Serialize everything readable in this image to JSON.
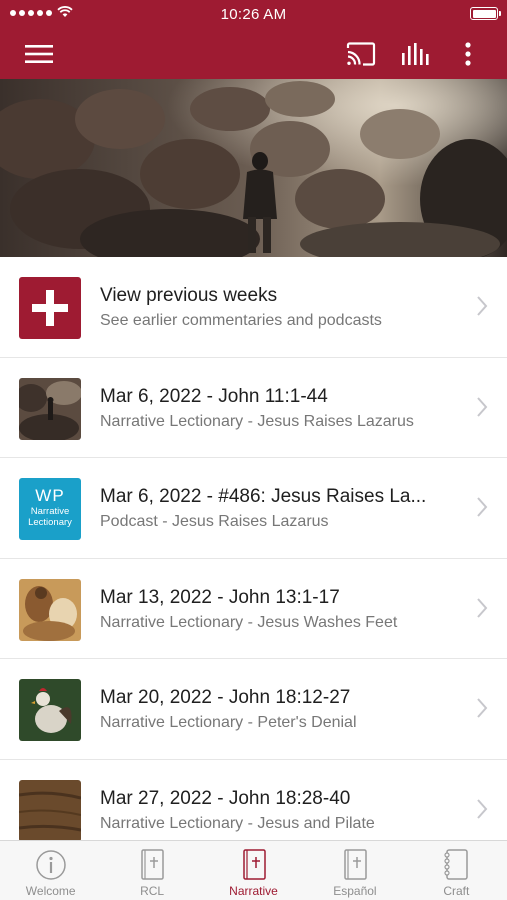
{
  "status_bar": {
    "time": "10:26 AM"
  },
  "app_bar": {
    "menu_icon": "hamburger-menu-icon",
    "cast_icon": "cast-icon",
    "audio_icon": "equalizer-icon",
    "more_icon": "more-vert-icon"
  },
  "hero": {
    "image": "cave-explorer-photo"
  },
  "list": [
    {
      "title": "View previous weeks",
      "subtitle": "See earlier commentaries and podcasts",
      "thumb": "plus-icon"
    },
    {
      "title": "Mar 6, 2022 - John 11:1-44",
      "subtitle": "Narrative Lectionary - Jesus Raises Lazarus",
      "thumb": "cave-thumbnail"
    },
    {
      "title": "Mar 6, 2022 - #486: Jesus Raises La...",
      "subtitle": "Podcast - Jesus Raises Lazarus",
      "thumb": "wp-narrative-lectionary-logo",
      "logo_text": {
        "wp": "WP",
        "line1": "Narrative",
        "line2": "Lectionary"
      }
    },
    {
      "title": "Mar 13, 2022 - John 13:1-17",
      "subtitle": "Narrative Lectionary - Jesus Washes Feet",
      "thumb": "painting-thumbnail"
    },
    {
      "title": "Mar 20, 2022 - John 18:12-27",
      "subtitle": "Narrative Lectionary - Peter's Denial",
      "thumb": "rooster-thumbnail"
    },
    {
      "title": "Mar 27, 2022 - John 18:28-40",
      "subtitle": "Narrative Lectionary - Jesus and Pilate",
      "thumb": "wood-thumbnail"
    }
  ],
  "tabs": [
    {
      "label": "Welcome",
      "icon": "info-icon"
    },
    {
      "label": "RCL",
      "icon": "bible-icon"
    },
    {
      "label": "Narrative",
      "icon": "bible-icon",
      "active": true
    },
    {
      "label": "Español",
      "icon": "bible-icon"
    },
    {
      "label": "Craft",
      "icon": "notebook-icon"
    }
  ],
  "colors": {
    "brand": "#9e1b32",
    "inactive": "#8e8e8e",
    "podcast_tile": "#1aa0c9"
  }
}
